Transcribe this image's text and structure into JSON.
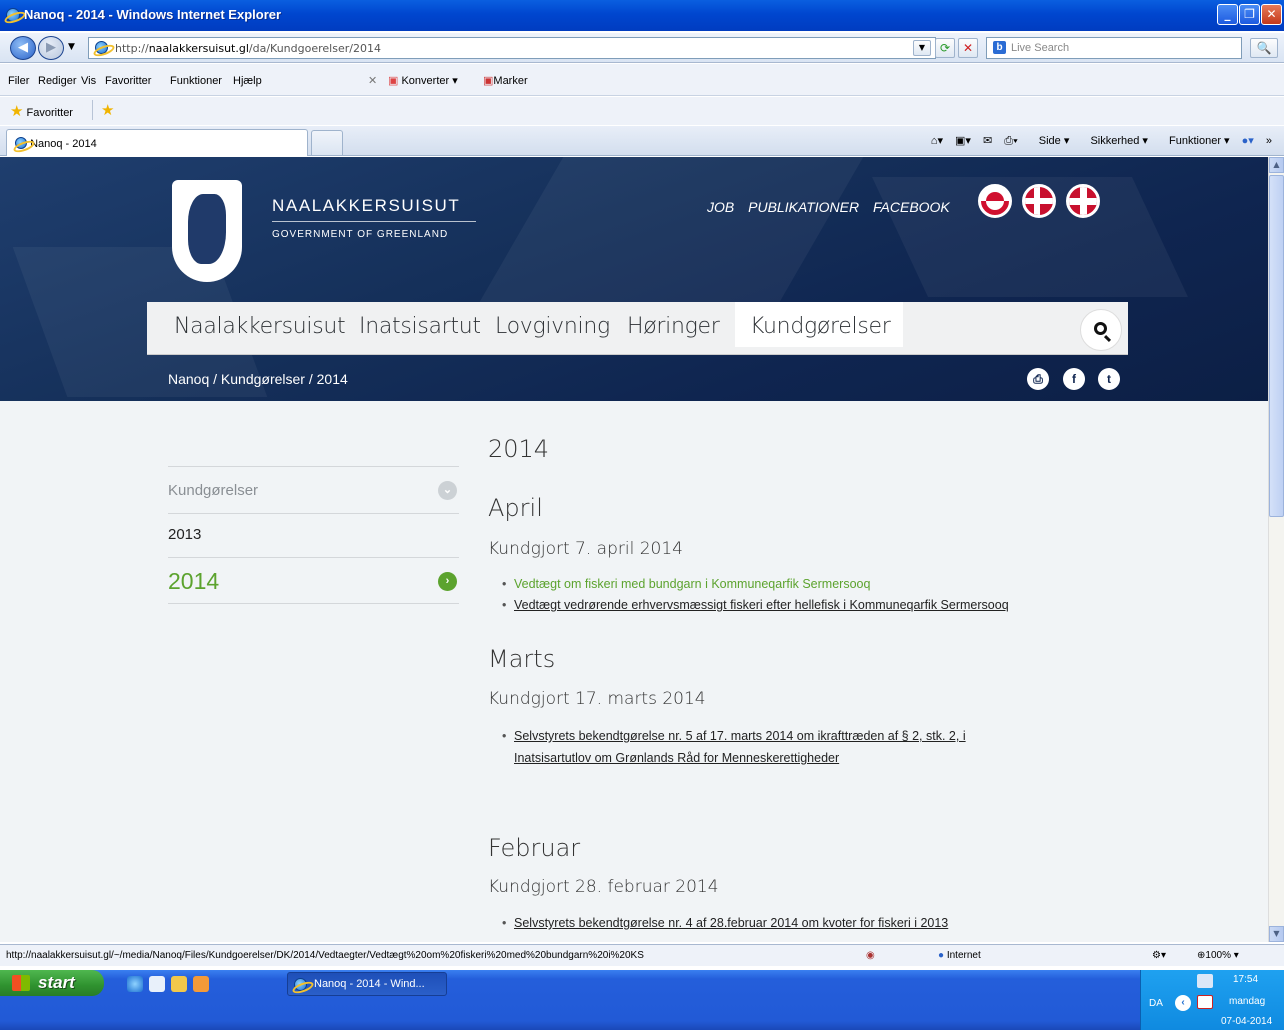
{
  "window": {
    "title": "Nanoq - 2014 - Windows Internet Explorer"
  },
  "address_bar": {
    "url_prefix": "http://",
    "url_host": "naalakkersuisut.gl",
    "url_path": "/da/Kundgoerelser/2014",
    "search_placeholder": "Live Search"
  },
  "menu": {
    "items": [
      "Filer",
      "Rediger",
      "Vis",
      "Favoritter",
      "Funktioner",
      "Hjælp"
    ],
    "convert_label": "Konverter",
    "select_label": "Marker"
  },
  "favorites_bar": {
    "label": "Favoritter"
  },
  "tab": {
    "label": "Nanoq - 2014"
  },
  "command_bar": {
    "side": "Side",
    "security": "Sikkerhed",
    "tools": "Funktioner"
  },
  "site": {
    "brand_title": "NAALAKKERSUISUT",
    "brand_subtitle": "GOVERNMENT OF GREENLAND",
    "top_links": [
      "JOB",
      "PUBLIKATIONER",
      "FACEBOOK"
    ],
    "nav": [
      "Naalakkersuisut",
      "Inatsisartut",
      "Lovgivning",
      "Høringer",
      "Kundgørelser"
    ],
    "breadcrumb": "Nanoq / Kundgørelser / 2014",
    "sidebar": {
      "heading": "Kundgørelser",
      "items": [
        "2013",
        "2014"
      ]
    },
    "page_title": "2014",
    "months": [
      {
        "name": "April",
        "dates": [
          {
            "label": "Kundgjort 7. april 2014",
            "links": [
              "Vedtægt om fiskeri med bundgarn i Kommuneqarfik Sermersooq",
              "Vedtægt vedrørende erhvervsmæssigt fiskeri efter hellefisk i Kommuneqarfik Sermersooq"
            ]
          }
        ]
      },
      {
        "name": "Marts",
        "dates": [
          {
            "label": "Kundgjort 17. marts 2014",
            "links": [
              "Selvstyrets bekendtgørelse nr. 5 af 17. marts 2014 om ikrafttræden af § 2, stk. 2, i",
              "Inatsisartutlov om Grønlands Råd for Menneskerettigheder"
            ]
          }
        ]
      },
      {
        "name": "Februar",
        "dates": [
          {
            "label": "Kundgjort 28. februar 2014",
            "links": [
              "Selvstyrets bekendtgørelse nr. 4 af 28.februar 2014 om kvoter for fiskeri i 2013"
            ]
          }
        ]
      }
    ]
  },
  "status_bar": {
    "url": "http://naalakkersuisut.gl/~/media/Nanoq/Files/Kundgoerelser/DK/2014/Vedtaegter/Vedtægt%20om%20fiskeri%20med%20bundgarn%20i%20KS",
    "zone": "Internet",
    "zoom": "100%"
  },
  "taskbar": {
    "start": "start",
    "window_item": "Nanoq - 2014 - Wind...",
    "lang": "DA",
    "time": "17:54",
    "day": "mandag",
    "date": "07-04-2014"
  },
  "colors": {
    "accent_green": "#5ca32e",
    "hero_navy": "#15305a",
    "page_bg": "#f1f4f6"
  }
}
